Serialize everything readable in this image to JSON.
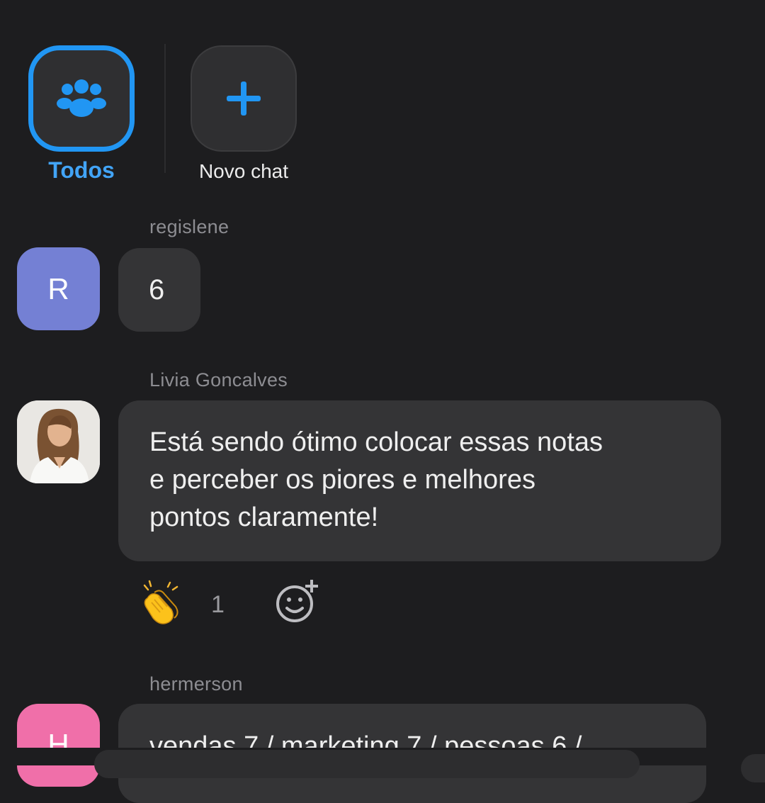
{
  "filters": [
    {
      "label": "Todos",
      "icon": "group-icon",
      "active": true
    },
    {
      "label": "Novo chat",
      "icon": "plus-icon",
      "active": false
    }
  ],
  "colors": {
    "accent": "#2196f3",
    "background": "#1d1d1f",
    "bubble": "#343436"
  },
  "messages": [
    {
      "sender": "regislene",
      "avatar_initial": "R",
      "avatar_color": "#7480d4",
      "text": "6"
    },
    {
      "sender": "Livia Goncalves",
      "avatar": "profile-photo",
      "lines": [
        "Está sendo ótimo colocar essas notas",
        "e perceber os piores e melhores",
        "pontos claramente!"
      ],
      "reaction": {
        "emoji": "clapping-hands-icon",
        "count": "1"
      }
    },
    {
      "sender": "hermerson",
      "avatar_initial": "H",
      "avatar_color": "#f06fa9",
      "text": "vendas 7 / marketing 7 / pessoas 6 /"
    }
  ]
}
